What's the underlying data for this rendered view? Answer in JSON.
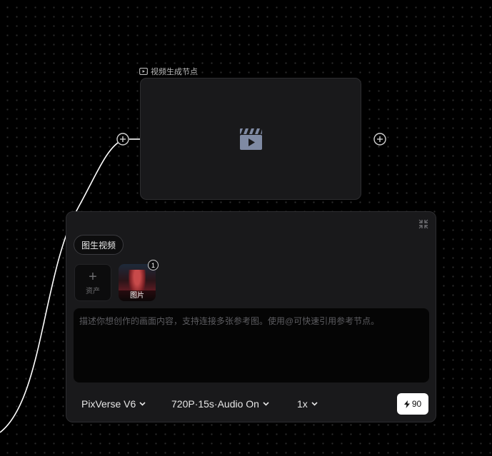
{
  "node": {
    "title": "视频生成节点",
    "icons": {
      "title": "video-node-icon",
      "placeholder": "clapperboard-play-icon",
      "port": "add-port-icon"
    }
  },
  "panel": {
    "mode_label": "图生视频",
    "add_asset_label": "资产",
    "reference_image": {
      "caption": "图片",
      "badge": "1"
    },
    "prompt_placeholder": "描述你想创作的画面内容，支持连接多张参考图。使用@可快速引用参考节点。",
    "model_label": "PixVerse V6",
    "spec_label": "720P·15s·Audio On",
    "count_label": "1x",
    "credits": "90",
    "colors": {
      "accent_white": "#ffffff",
      "panel_bg": "#19191b",
      "canvas_bg": "#000000"
    }
  }
}
